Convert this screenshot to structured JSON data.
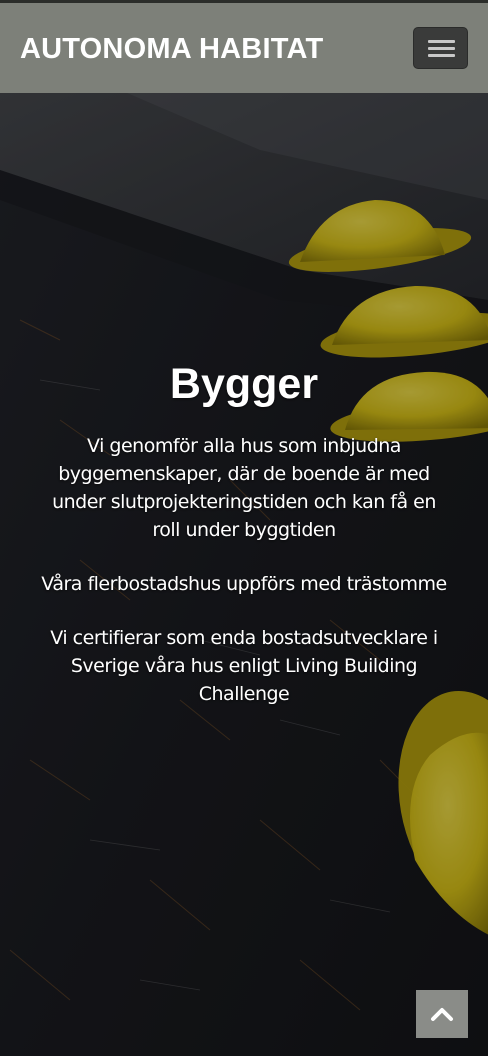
{
  "navbar": {
    "brand": "AUTONOMA HABITAT",
    "menu_icon": "hamburger-menu-icon",
    "background_color": "#7d8079"
  },
  "hero": {
    "background": "construction-site-yellow-hard-hats",
    "title": "Bygger",
    "paragraphs": [
      "Vi genomför alla hus som inbjudna byggemenskaper, där de boende är med under slutprojekteringstiden och kan få en roll under byggtiden",
      "Våra flerbostadshus uppförs med trästomme",
      "Vi certifierar som enda bostadsutvecklare i Sverige våra hus enligt Living Building Challenge"
    ]
  },
  "back_to_top": {
    "icon": "chevron-up-icon",
    "background_color": "#8a8c88"
  },
  "colors": {
    "hard_hat_yellow": "#e6cf16",
    "text": "#ffffff",
    "dark_ground": "#17181c"
  }
}
